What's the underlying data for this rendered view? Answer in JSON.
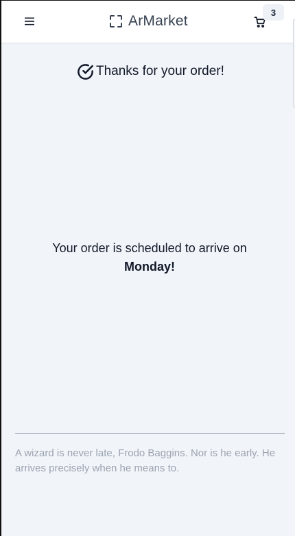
{
  "header": {
    "brand": "ArMarket",
    "cart_count": "3",
    "icons": {
      "menu": "hamburger-menu-icon",
      "brand": "scan-frame-icon",
      "cart": "shopping-cart-icon"
    }
  },
  "confirmation": {
    "title": "Thanks for your order!",
    "icon": "check-circle-icon",
    "schedule_text": "Your order is scheduled to arrive on",
    "schedule_day": "Monday!"
  },
  "footer": {
    "quote": "A wizard is never late, Frodo Baggins. Nor is he early. He arrives precisely when he means to."
  },
  "colors": {
    "background": "#f1f4f9",
    "header_bg": "#ffffff",
    "muted_text": "#9ca3af"
  }
}
